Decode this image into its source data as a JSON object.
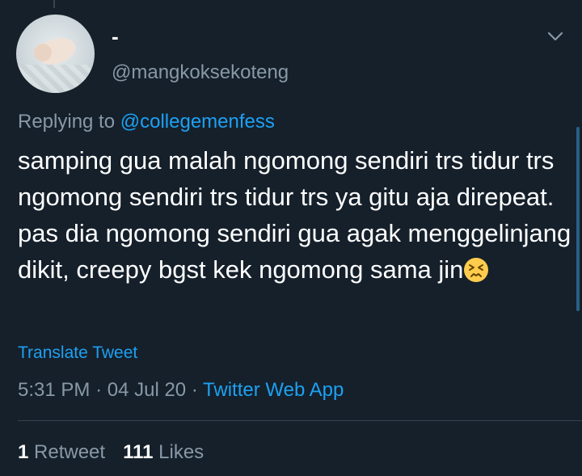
{
  "author": {
    "display_name": "-",
    "handle": "@mangkoksekoteng"
  },
  "reply": {
    "prefix": "Replying to",
    "mention": "@collegemenfess"
  },
  "tweet": {
    "text": "samping gua malah ngomong sendiri trs tidur trs ngomong sendiri trs tidur trs ya gitu aja direpeat. pas dia ngomong sendiri gua agak menggelinjang dikit, creepy bgst kek ngomong sama jin",
    "emoji": "😣"
  },
  "translate_label": "Translate Tweet",
  "meta": {
    "time": "5:31 PM",
    "separator": "·",
    "date": "04 Jul 20",
    "source": "Twitter Web App"
  },
  "stats": {
    "retweets_count": "1",
    "retweets_label": "Retweet",
    "likes_count": "111",
    "likes_label": "Likes"
  },
  "colors": {
    "background": "#15202b",
    "link": "#1da1f2",
    "secondary_text": "#8899a6"
  },
  "icons": {
    "menu": "chevron-down-icon",
    "emoji": "persevering-face-emoji"
  }
}
